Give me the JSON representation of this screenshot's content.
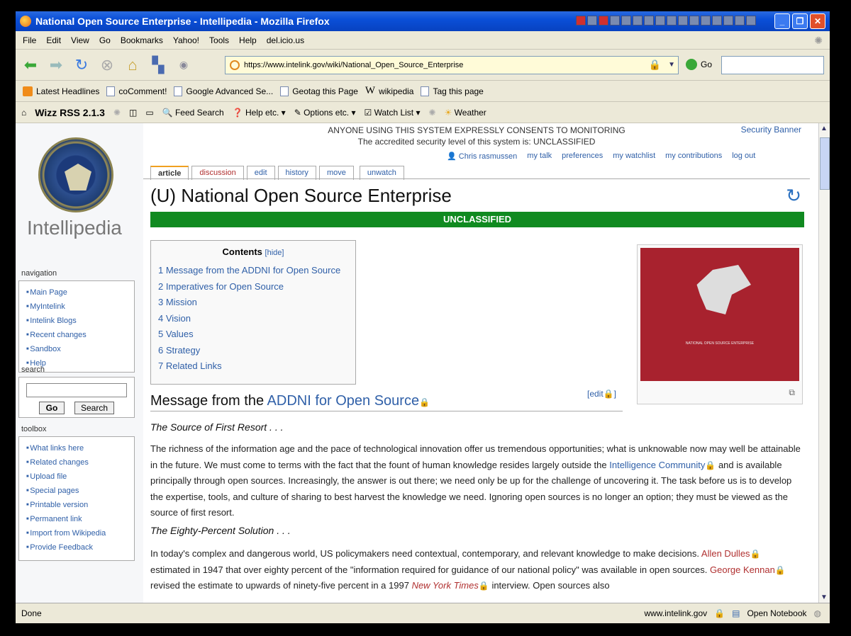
{
  "window": {
    "title": "National Open Source Enterprise - Intellipedia - Mozilla Firefox"
  },
  "menu": [
    "File",
    "Edit",
    "View",
    "Go",
    "Bookmarks",
    "Yahoo!",
    "Tools",
    "Help",
    "del.icio.us"
  ],
  "address": {
    "url": "https://www.intelink.gov/wiki/National_Open_Source_Enterprise",
    "go_label": "Go"
  },
  "bookmarks": [
    "Latest Headlines",
    "coComment!",
    "Google Advanced Se...",
    "Geotag this Page",
    "wikipedia",
    "Tag this page"
  ],
  "wizz": {
    "title": "Wizz RSS 2.1.3",
    "items": [
      "Feed Search",
      "Help etc.",
      "Options etc.",
      "Watch List",
      "Weather"
    ]
  },
  "banner": {
    "line1": "ANYONE USING THIS SYSTEM EXPRESSLY CONSENTS TO MONITORING",
    "line2": "The accredited security level of this system is: UNCLASSIFIED",
    "link": "Security Banner"
  },
  "user_links": [
    "Chris rasmussen",
    "my talk",
    "preferences",
    "my watchlist",
    "my contributions",
    "log out"
  ],
  "tabs": [
    "article",
    "discussion",
    "edit",
    "history",
    "move",
    "unwatch"
  ],
  "sidebar": {
    "wiki_name": "Intellipedia",
    "navigation_label": "navigation",
    "navigation": [
      "Main Page",
      "MyIntelink",
      "Intelink Blogs",
      "Recent changes",
      "Sandbox",
      "Help"
    ],
    "search_label": "search",
    "go_button": "Go",
    "search_button": "Search",
    "toolbox_label": "toolbox",
    "toolbox": [
      "What links here",
      "Related changes",
      "Upload file",
      "Special pages",
      "Printable version",
      "Permanent link",
      "Import from Wikipedia",
      "Provide Feedback"
    ]
  },
  "page": {
    "title": "(U) National Open Source Enterprise",
    "classification": "UNCLASSIFIED",
    "toc_title": "Contents",
    "toc_hide": "[hide]",
    "toc": [
      "1 Message from the ADDNI for Open Source",
      "2 Imperatives for Open Source",
      "3 Mission",
      "4 Vision",
      "5 Values",
      "6 Strategy",
      "7 Related Links"
    ],
    "image_caption": "NATIONAL OPEN SOURCE ENTERPRISE",
    "edit_link": "[edit",
    "section_prefix": "Message from the ",
    "section_link": "ADDNI for Open Source",
    "sub1": "The Source of First Resort . . .",
    "para1a": "The richness of the information age and the pace of technological innovation offer us tremendous opportunities; what is unknowable now may well be attainable in the future. We must come to terms with the fact that the fount of human knowledge resides largely outside the",
    "para1_link": "Intelligence Community",
    "para1b": "and is available principally through open sources. Increasingly, the answer is out there; we need only be up for the challenge of uncovering it. The task before us is to develop the expertise, tools, and culture of sharing to best harvest the knowledge we need. Ignoring open sources is no longer an option; they must be viewed as the source of first resort.",
    "sub2": "The Eighty-Percent Solution . . .",
    "para2a": "In today's complex and dangerous world, US policymakers need contextual, contemporary, and relevant knowledge to make decisions.",
    "para2_link1": "Allen Dulles",
    "para2b": "estimated in 1947 that over eighty percent of the \"information required for guidance of our national policy\" was available in open sources.",
    "para2_link2": "George Kennan",
    "para2c": "revised the estimate to upwards of ninety-five percent in a 1997",
    "para2_link3": "New York Times",
    "para2d": "interview. Open sources also"
  },
  "status": {
    "text": "Done",
    "domain": "www.intelink.gov",
    "notebook": "Open Notebook"
  }
}
